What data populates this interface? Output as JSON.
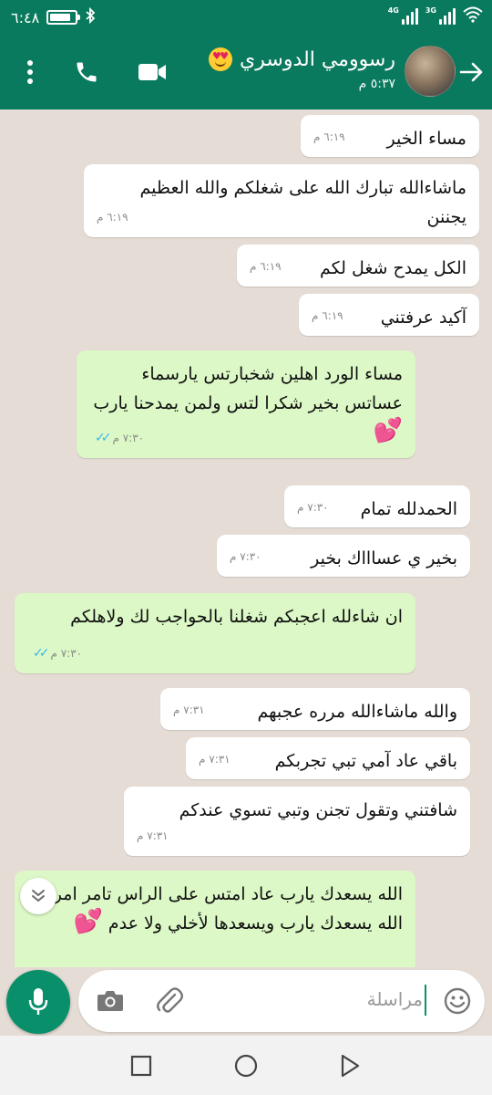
{
  "status_bar": {
    "time": "٦:٤٨",
    "battery_level": 0.85,
    "network_1": "4G",
    "network_2": "3G",
    "wifi_icon": "wifi-icon",
    "bluetooth_icon": "bluetooth-icon"
  },
  "header": {
    "contact_name": "رسوومي الدوسري",
    "name_emoji": "smiling-face-with-heart-eyes",
    "last_seen": "٥:٣٧ م",
    "icons": [
      "back-arrow-icon",
      "video-call-icon",
      "voice-call-icon",
      "more-options-icon"
    ]
  },
  "messages": [
    {
      "dir": "in",
      "text": "مساء الخير",
      "time": "٦:١٩ م"
    },
    {
      "dir": "in",
      "text": "ماشاءالله تبارك الله على شغلكم والله العظيم يجننن",
      "time": "٦:١٩ م"
    },
    {
      "dir": "in",
      "text": "الكل يمدح شغل لكم",
      "time": "٦:١٩ م"
    },
    {
      "dir": "in",
      "text": "آكيد عرفتني",
      "time": "٦:١٩ م"
    },
    {
      "dir": "out",
      "text": "مساء الورد اهلين شخبارتس يارسماء عساتس بخير شكرا لتس ولمن يمدحنا يارب",
      "emoji": "💕",
      "time": "٧:٣٠ م",
      "status": "read"
    },
    {
      "dir": "in",
      "text": "الحمدلله تمام",
      "time": "٧:٣٠ م"
    },
    {
      "dir": "in",
      "text": "بخير ي عساااك بخير",
      "time": "٧:٣٠ م"
    },
    {
      "dir": "out",
      "text": "ان شاءلله اعجبكم شغلنا بالحواجب لك ولاهلكم",
      "time": "٧:٣٠ م",
      "status": "read"
    },
    {
      "dir": "in",
      "text": "والله ماشاءالله مرره عجبهم",
      "time": "٧:٣١ م"
    },
    {
      "dir": "in",
      "text": "باقي عاد آمي تبي تجربكم",
      "time": "٧:٣١ م"
    },
    {
      "dir": "in",
      "text": "شافتني وتقول تجنن وتبي تسوي عندكم",
      "time": "٧:٣١ م"
    },
    {
      "dir": "out",
      "text": "الله يسعدك يارب عاد امتس على الراس تامر امر الله يسعدك يارب ويسعدها لأخلي ولا عدم",
      "emoji": "💕",
      "time": "",
      "status": ""
    }
  ],
  "input": {
    "placeholder": "مراسلة"
  },
  "colors": {
    "header": "#0a7a5e",
    "outgoing": "#dcf8c6",
    "incoming": "#ffffff",
    "background": "#e5ddd5",
    "read_ticks": "#34b7f1"
  }
}
